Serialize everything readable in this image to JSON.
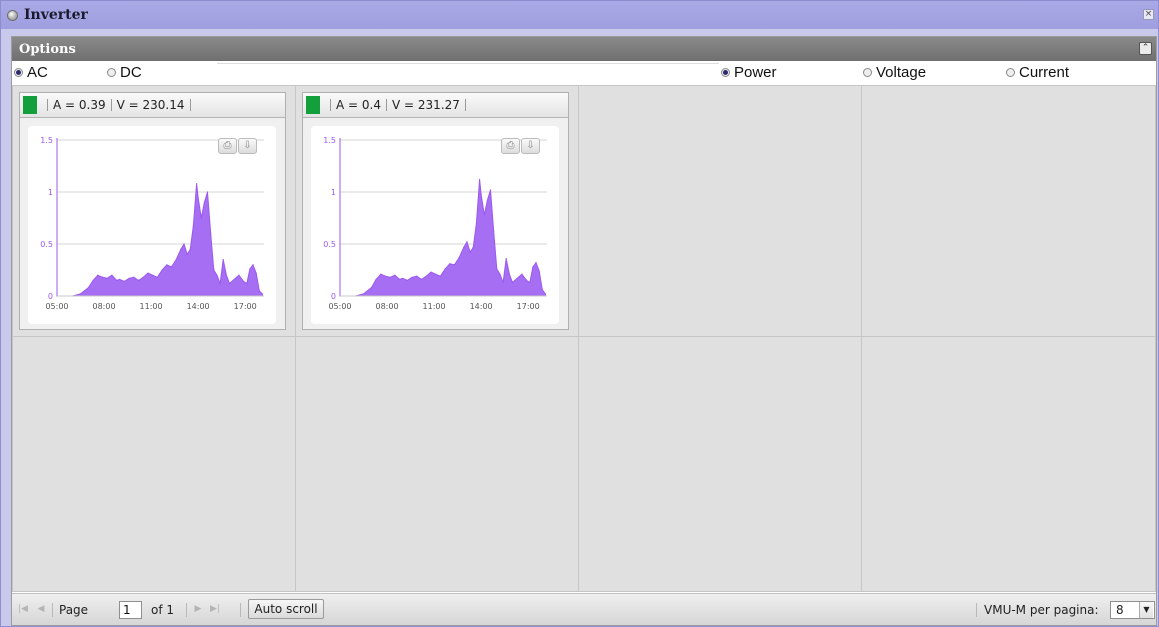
{
  "window": {
    "title": "Inverter"
  },
  "options": {
    "title": "Options",
    "source_options": [
      {
        "label": "AC",
        "selected": true
      },
      {
        "label": "DC",
        "selected": false
      }
    ],
    "measure_options": [
      {
        "label": "Power",
        "selected": true
      },
      {
        "label": "Voltage",
        "selected": false
      },
      {
        "label": "Current",
        "selected": false
      }
    ]
  },
  "panels": [
    {
      "status_color": "#139f3c",
      "current_label": "A = 0.39",
      "voltage_label": "V = 230.14",
      "chart_data": {
        "type": "area",
        "title": "",
        "xlabel": "",
        "ylabel": "",
        "x_ticks": [
          "05:00",
          "08:00",
          "11:00",
          "14:00",
          "17:00"
        ],
        "y_ticks": [
          "0",
          "0.5",
          "1",
          "1.5"
        ],
        "ylim": [
          0,
          1.5
        ],
        "xlim": [
          5,
          18.2
        ],
        "series_color": "#9b59f0",
        "x": [
          5.0,
          6.0,
          6.5,
          7.0,
          7.3,
          7.6,
          7.9,
          8.2,
          8.5,
          8.8,
          9.0,
          9.3,
          9.6,
          9.9,
          10.2,
          10.5,
          10.8,
          11.1,
          11.4,
          11.7,
          12.0,
          12.3,
          12.6,
          12.9,
          13.1,
          13.3,
          13.5,
          13.7,
          13.9,
          14.0,
          14.2,
          14.4,
          14.6,
          14.8,
          15.0,
          15.2,
          15.4,
          15.6,
          15.8,
          16.0,
          16.3,
          16.6,
          16.9,
          17.1,
          17.3,
          17.5,
          17.7,
          17.9,
          18.1
        ],
        "y": [
          0.0,
          0.0,
          0.02,
          0.08,
          0.15,
          0.2,
          0.18,
          0.17,
          0.2,
          0.15,
          0.16,
          0.14,
          0.17,
          0.18,
          0.15,
          0.18,
          0.22,
          0.2,
          0.18,
          0.25,
          0.3,
          0.28,
          0.35,
          0.45,
          0.5,
          0.4,
          0.45,
          0.68,
          1.08,
          0.95,
          0.75,
          0.9,
          1.0,
          0.6,
          0.25,
          0.2,
          0.12,
          0.35,
          0.2,
          0.12,
          0.16,
          0.2,
          0.14,
          0.12,
          0.26,
          0.3,
          0.22,
          0.05,
          0.02
        ]
      }
    },
    {
      "status_color": "#139f3c",
      "current_label": "A = 0.4",
      "voltage_label": "V = 231.27",
      "chart_data": {
        "type": "area",
        "title": "",
        "xlabel": "",
        "ylabel": "",
        "x_ticks": [
          "05:00",
          "08:00",
          "11:00",
          "14:00",
          "17:00"
        ],
        "y_ticks": [
          "0",
          "0.5",
          "1",
          "1.5"
        ],
        "ylim": [
          0,
          1.5
        ],
        "xlim": [
          5,
          18.2
        ],
        "series_color": "#9b59f0",
        "x": [
          5.0,
          6.0,
          6.5,
          7.0,
          7.3,
          7.6,
          7.9,
          8.2,
          8.5,
          8.8,
          9.0,
          9.3,
          9.6,
          9.9,
          10.2,
          10.5,
          10.8,
          11.1,
          11.4,
          11.7,
          12.0,
          12.3,
          12.6,
          12.9,
          13.1,
          13.3,
          13.5,
          13.7,
          13.9,
          14.0,
          14.2,
          14.4,
          14.6,
          14.8,
          15.0,
          15.2,
          15.4,
          15.6,
          15.8,
          16.0,
          16.3,
          16.6,
          16.9,
          17.1,
          17.3,
          17.5,
          17.7,
          17.9,
          18.1
        ],
        "y": [
          0.0,
          0.0,
          0.02,
          0.08,
          0.16,
          0.21,
          0.19,
          0.18,
          0.2,
          0.16,
          0.17,
          0.15,
          0.18,
          0.19,
          0.16,
          0.19,
          0.23,
          0.21,
          0.19,
          0.26,
          0.31,
          0.3,
          0.37,
          0.47,
          0.52,
          0.42,
          0.47,
          0.7,
          1.12,
          0.98,
          0.78,
          0.92,
          1.02,
          0.62,
          0.26,
          0.21,
          0.13,
          0.36,
          0.21,
          0.13,
          0.17,
          0.21,
          0.15,
          0.13,
          0.28,
          0.32,
          0.24,
          0.06,
          0.02
        ]
      }
    }
  ],
  "footer": {
    "page_label": "Page",
    "page_value": "1",
    "of_label": "of 1",
    "auto_scroll_label": "Auto scroll",
    "per_page_label": "VMU-M per pagina:",
    "per_page_value": "8"
  }
}
